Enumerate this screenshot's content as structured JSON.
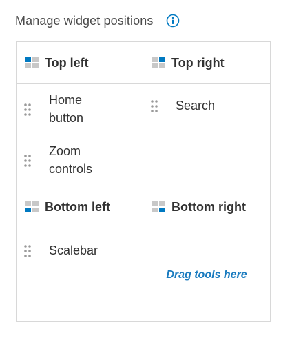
{
  "header": {
    "title": "Manage widget positions",
    "info_icon": "info-icon"
  },
  "colors": {
    "accent": "#0079c1",
    "icon_gray": "#c8c8c8",
    "text": "#323232",
    "border": "#d8d8d8",
    "drop_text": "#1a7bbf"
  },
  "quadrants": {
    "top_left": {
      "title": "Top left",
      "icon": "position-top-left-icon",
      "items": [
        {
          "label": "Home button"
        },
        {
          "label": "Zoom controls"
        }
      ]
    },
    "top_right": {
      "title": "Top right",
      "icon": "position-top-right-icon",
      "items": [
        {
          "label": "Search"
        }
      ]
    },
    "bottom_left": {
      "title": "Bottom left",
      "icon": "position-bottom-left-icon",
      "items": [
        {
          "label": "Scalebar"
        }
      ]
    },
    "bottom_right": {
      "title": "Bottom right",
      "icon": "position-bottom-right-icon",
      "items": [],
      "empty_text": "Drag tools here"
    }
  }
}
